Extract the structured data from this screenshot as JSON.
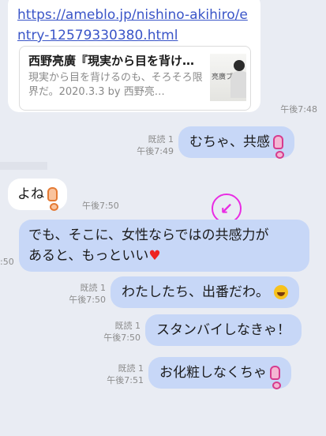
{
  "link_card": {
    "url": "https://ameblo.jp/nishino-akihiro/entry-12579330380.html",
    "preview_title": "西野亮廣『現実から目を背け…",
    "preview_desc": "現実から目を背けるのも、そろそろ限界だ。2020.3.3 by 西野亮…",
    "thumb_text": "亮廣ブログ",
    "time": "午後7:48"
  },
  "messages": [
    {
      "text": "むちゃ、共感",
      "read": "既読 1",
      "time": "午後7:49"
    },
    {
      "text": "よね",
      "time": "午後7:50"
    },
    {
      "text_line1": "でも、そこに、女性ならではの共感力が",
      "text_line2": "あると、もっといい",
      "edge_time": ":50"
    },
    {
      "text": "わたしたち、出番だわ。",
      "read": "既読 1",
      "time": "午後7:50"
    },
    {
      "text": "スタンバイしなきゃ！",
      "read": "既読 1",
      "time": "午後7:50"
    },
    {
      "text": "お化粧しなくちゃ",
      "read": "既読 1",
      "time": "午後7:51"
    }
  ],
  "annotation": {
    "symbol": "↙",
    "color": "#e92ce3"
  },
  "colors": {
    "outgoing_bubble": "#c7d7f7",
    "incoming_bubble": "#ffffff",
    "link": "#3a55c8",
    "background": "#e9ecf3"
  }
}
